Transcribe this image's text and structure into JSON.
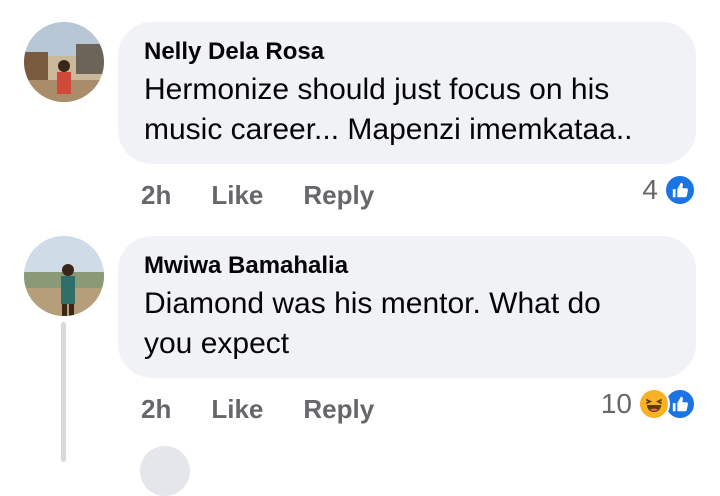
{
  "comments": [
    {
      "author": "Nelly Dela Rosa",
      "text_line1": "Hermonize should just focus on his",
      "text_line2": "music career... Mapenzi imemkataa..",
      "time": "2h",
      "like_label": "Like",
      "reply_label": "Reply",
      "reaction_count": "4",
      "reactions": [
        "like-icon"
      ]
    },
    {
      "author": "Mwiwa Bamahalia",
      "text_line1": "Diamond was his mentor. What do",
      "text_line2": "you expect",
      "time": "2h",
      "like_label": "Like",
      "reply_label": "Reply",
      "reaction_count": "10",
      "reactions": [
        "haha-icon",
        "like-icon"
      ]
    }
  ],
  "colors": {
    "bubble": "#f0f2f5",
    "meta": "#65676b",
    "like_blue": "#1b74e4",
    "haha_yellow": "#f7b125"
  }
}
